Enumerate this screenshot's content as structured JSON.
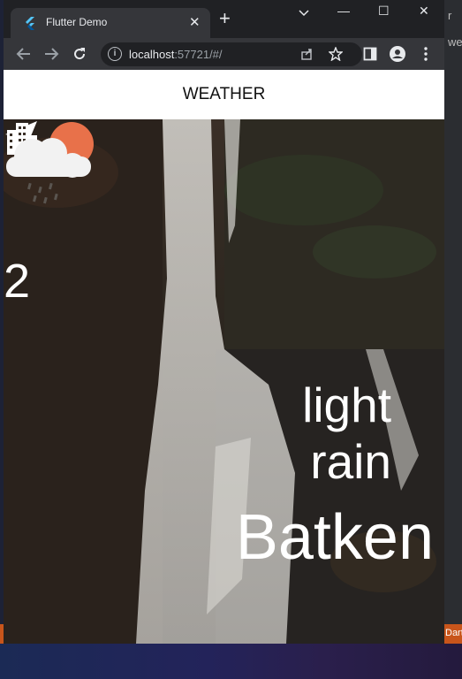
{
  "browser": {
    "tab_title": "Flutter Demo",
    "tab_close": "✕",
    "new_tab": "+",
    "window_controls": {
      "minimize": "—",
      "maximize": "☐",
      "close": "✕"
    },
    "url_host": "localhost",
    "url_rest": ":57721/#/"
  },
  "appbar": {
    "title": "WEATHER"
  },
  "weather": {
    "temperature": "2",
    "description": "light rain",
    "city": "Batken",
    "icon": "cloud-sun-rain-icon"
  },
  "desktop": {
    "frag_top": "r",
    "frag_we": "we",
    "frag_bottom": "Dart"
  },
  "colors": {
    "sun": "#e8714a",
    "cloud": "#f2f2f2",
    "appbar_bg": "#ffffff",
    "tab_bg": "#35363a"
  }
}
